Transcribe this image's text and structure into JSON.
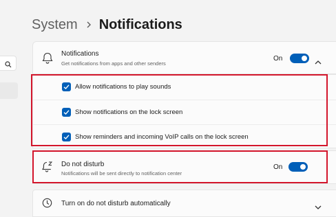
{
  "breadcrumb": {
    "parent": "System",
    "current": "Notifications"
  },
  "notifications": {
    "title": "Notifications",
    "description": "Get notifications from apps and other senders",
    "state": "On",
    "enabled": true,
    "options": [
      {
        "label": "Allow notifications to play sounds",
        "checked": true
      },
      {
        "label": "Show notifications on the lock screen",
        "checked": true
      },
      {
        "label": "Show reminders and incoming VoIP calls on the lock screen",
        "checked": true
      }
    ]
  },
  "do_not_disturb": {
    "title": "Do not disturb",
    "description": "Notifications will be sent directly to notification center",
    "state": "On",
    "enabled": true
  },
  "auto_dnd": {
    "title": "Turn on do not disturb automatically"
  },
  "colors": {
    "accent": "#005fb8",
    "highlight": "#d3152b"
  },
  "icons": [
    "search-icon",
    "chevron-right-icon",
    "bell-icon",
    "chevron-up-icon",
    "checkmark-icon",
    "bell-snooze-icon",
    "clock-icon",
    "chevron-down-icon"
  ]
}
